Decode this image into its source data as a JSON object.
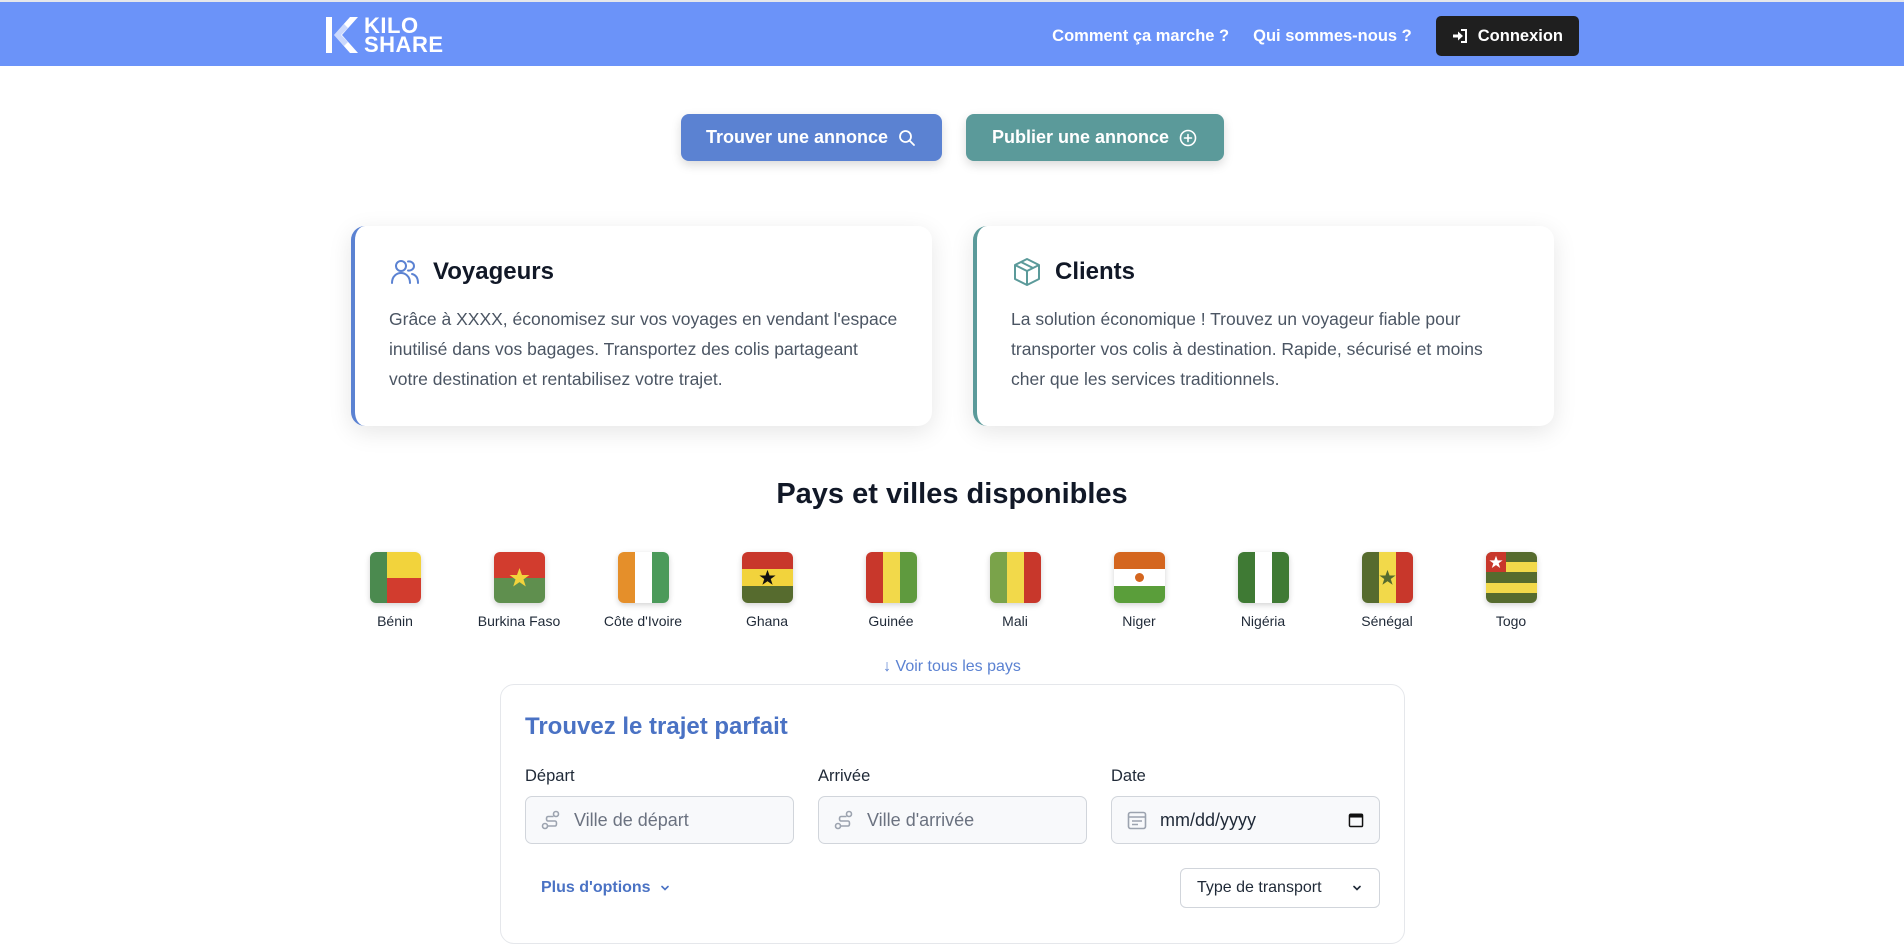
{
  "header": {
    "logo_line1": "KILO",
    "logo_line2": "SHARE",
    "nav_how": "Comment ça marche ?",
    "nav_who": "Qui sommes-nous ?",
    "login_label": "Connexion"
  },
  "actions": {
    "find_label": "Trouver une annonce",
    "publish_label": "Publier une annonce"
  },
  "cards": {
    "travelers": {
      "icon": "users-icon",
      "title": "Voyageurs",
      "text": "Grâce à XXXX, économisez sur vos voyages en vendant l'espace inutilisé dans vos bagages. Transportez des colis partageant votre destination et rentabilisez votre trajet."
    },
    "clients": {
      "icon": "package-icon",
      "title": "Clients",
      "text": "La solution économique ! Trouvez un voyageur fiable pour transporter vos colis à destination. Rapide, sécurisé et moins cher que les services traditionnels."
    }
  },
  "countries": {
    "title": "Pays et villes disponibles",
    "items": [
      {
        "name": "Bénin"
      },
      {
        "name": "Burkina Faso"
      },
      {
        "name": "Côte d'Ivoire"
      },
      {
        "name": "Ghana"
      },
      {
        "name": "Guinée"
      },
      {
        "name": "Mali"
      },
      {
        "name": "Niger"
      },
      {
        "name": "Nigéria"
      },
      {
        "name": "Sénégal"
      },
      {
        "name": "Togo"
      }
    ],
    "see_all": "↓ Voir tous les pays"
  },
  "search": {
    "title": "Trouvez le trajet parfait",
    "departure_label": "Départ",
    "departure_placeholder": "Ville de départ",
    "arrival_label": "Arrivée",
    "arrival_placeholder": "Ville d'arrivée",
    "date_label": "Date",
    "date_value": "mm/dd/yyyy",
    "more_options": "Plus d'options",
    "transport_type": "Type de transport"
  },
  "colors": {
    "header_bg": "#6b93f9",
    "primary": "#5b82d2",
    "teal": "#5b9a9a",
    "dark": "#1f1f1f"
  }
}
